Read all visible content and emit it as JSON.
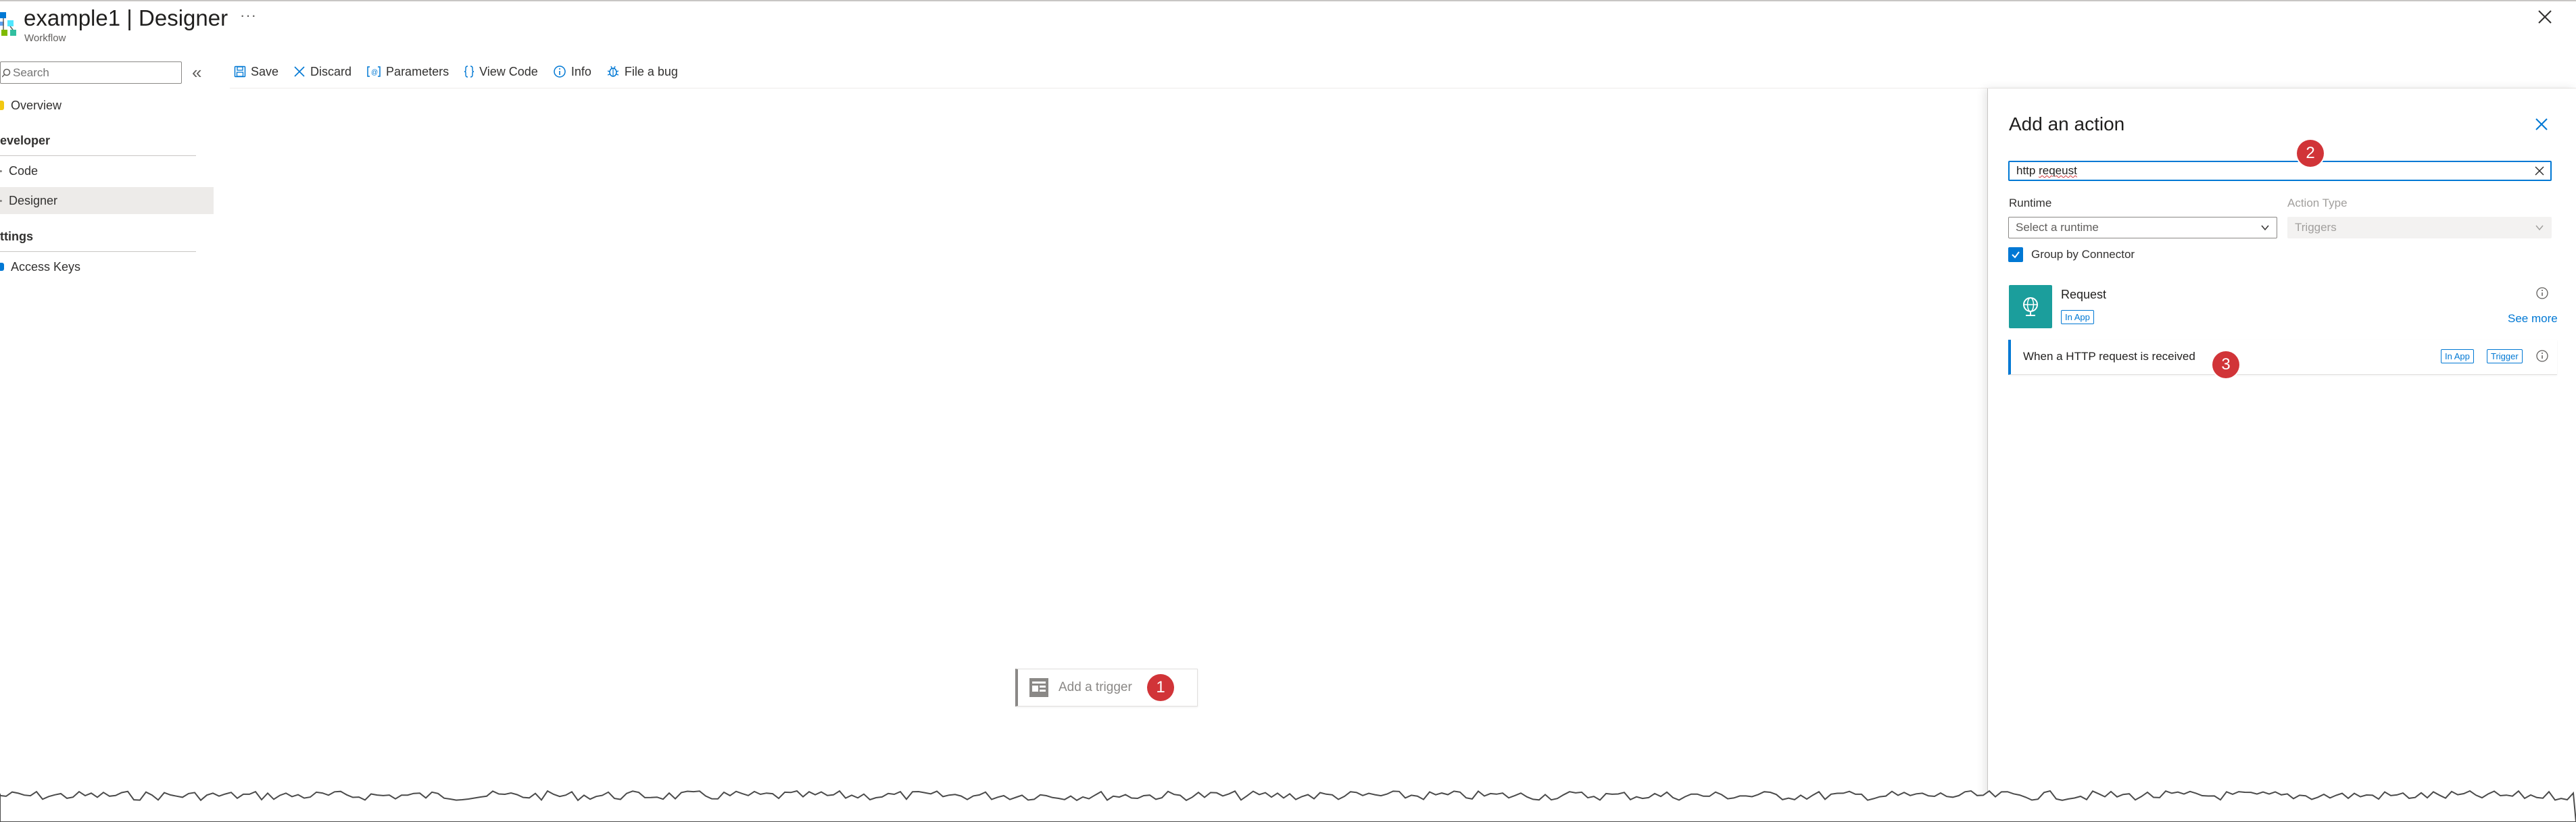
{
  "header": {
    "title_name": "example1",
    "title_sep": "|",
    "title_page": "Designer",
    "subtitle": "Workflow",
    "more_label": "···"
  },
  "sidebar": {
    "search_placeholder": "Search",
    "collapse_glyph": "«",
    "items": [
      {
        "label": "Overview"
      },
      {
        "label": "Code"
      },
      {
        "label": "Designer"
      },
      {
        "label": "Access Keys"
      }
    ],
    "groups": [
      {
        "label": "eveloper"
      },
      {
        "label": "ttings"
      }
    ]
  },
  "toolbar": {
    "save_label": "Save",
    "discard_label": "Discard",
    "parameters_label": "Parameters",
    "view_code_label": "View Code",
    "info_label": "Info",
    "file_bug_label": "File a bug"
  },
  "canvas": {
    "add_trigger_label": "Add a trigger",
    "badge_1": "1"
  },
  "panel": {
    "title": "Add an action",
    "search_value_prefix": "http ",
    "search_value_word": "reqeust",
    "badge_2": "2",
    "runtime_label": "Runtime",
    "runtime_placeholder": "Select a runtime",
    "action_type_label": "Action Type",
    "action_type_value": "Triggers",
    "group_by_connector_label": "Group by Connector",
    "connector": {
      "name": "Request",
      "tag": "In App",
      "see_more": "See more"
    },
    "result": {
      "label": "When a HTTP request is received",
      "tag1": "In App",
      "tag2": "Trigger",
      "badge_3": "3"
    }
  },
  "colors": {
    "accent": "#0078d4",
    "badge": "#d13438",
    "connector_tile": "#1b9e9c"
  }
}
